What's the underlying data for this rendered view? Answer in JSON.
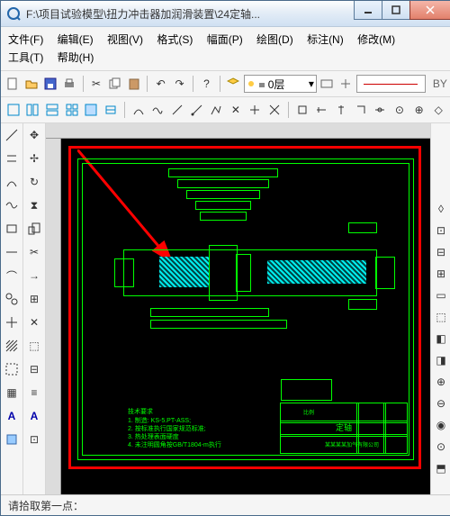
{
  "title": "F:\\项目试验模型\\扭力冲击器加润滑装置\\24定轴...",
  "menu": {
    "file": "文件(F)",
    "edit": "编辑(E)",
    "view": "视图(V)",
    "format": "格式(S)",
    "canvas": "幅面(P)",
    "draw": "绘图(D)",
    "annotate": "标注(N)",
    "modify": "修改(M)",
    "tools": "工具(T)",
    "help": "帮助(H)"
  },
  "layer": {
    "label": "0层"
  },
  "by": "BY",
  "status": "请拾取第一点：",
  "drawing_notes": {
    "title": "技术要求",
    "lines": [
      "1. 制造: KS-5.PT-ASS;",
      "2. 按标准执行国家规范标准;",
      "3. 热处理表面硬度",
      "4. 未注明圆角按GB/T1804-m执行"
    ]
  },
  "titleblock": {
    "name": "定轴",
    "company": "某某某某加气有限公司",
    "sheet": "比例"
  },
  "icons": {
    "tb1": [
      "new",
      "open",
      "save",
      "print",
      "cut",
      "copy",
      "paste",
      "undo",
      "redo",
      "help",
      "layers",
      "props"
    ],
    "tb2": [
      "win1",
      "win2",
      "win3",
      "win4",
      "win5",
      "win6",
      "sep",
      "arc1",
      "arc2",
      "line1",
      "line2",
      "poly1",
      "poly2",
      "poly3",
      "poly4",
      "sep",
      "sym1",
      "sym2",
      "sym3",
      "sym4",
      "sym5",
      "sym6",
      "sym7",
      "sym8"
    ],
    "left1": [
      "line",
      "pline",
      "circle",
      "arc",
      "ellipse",
      "spline",
      "rect",
      "poly",
      "dim",
      "hatch",
      "crop",
      "sketch",
      "text",
      "block"
    ],
    "left2": [
      "move",
      "pan",
      "rotate",
      "mirror",
      "scale",
      "trim",
      "extend",
      "array",
      "erase",
      "pick",
      "break",
      "align",
      "measure",
      "attr"
    ],
    "right": [
      "c1",
      "c2",
      "c3",
      "c4",
      "c5",
      "c6",
      "c7",
      "c8",
      "c9",
      "c10",
      "c11",
      "c12",
      "c13"
    ]
  }
}
